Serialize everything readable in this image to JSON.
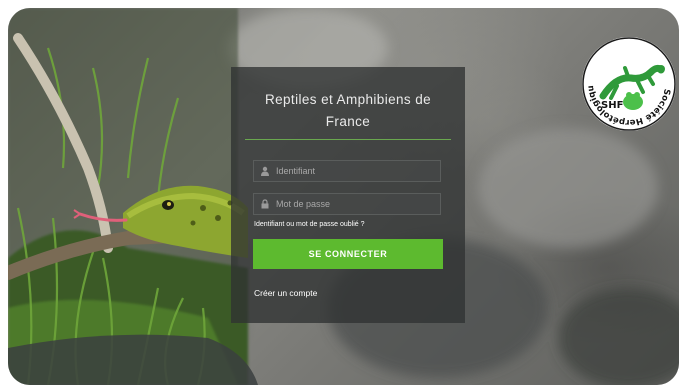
{
  "login": {
    "title": "Reptiles et Amphibiens de France",
    "username_placeholder": "Identifiant",
    "password_placeholder": "Mot de passe",
    "forgot_link": "Identifiant ou mot de passe oublié ?",
    "submit_label": "SE CONNECTER",
    "create_account_link": "Créer un compte"
  },
  "logo": {
    "ring_text": "Société Herpétologique de France",
    "abbr": "SHF"
  },
  "icons": {
    "username": "user-icon",
    "password": "lock-icon"
  },
  "colors": {
    "accent": "#5dba2f",
    "panel": "#303232",
    "rule": "#6aa84f"
  }
}
